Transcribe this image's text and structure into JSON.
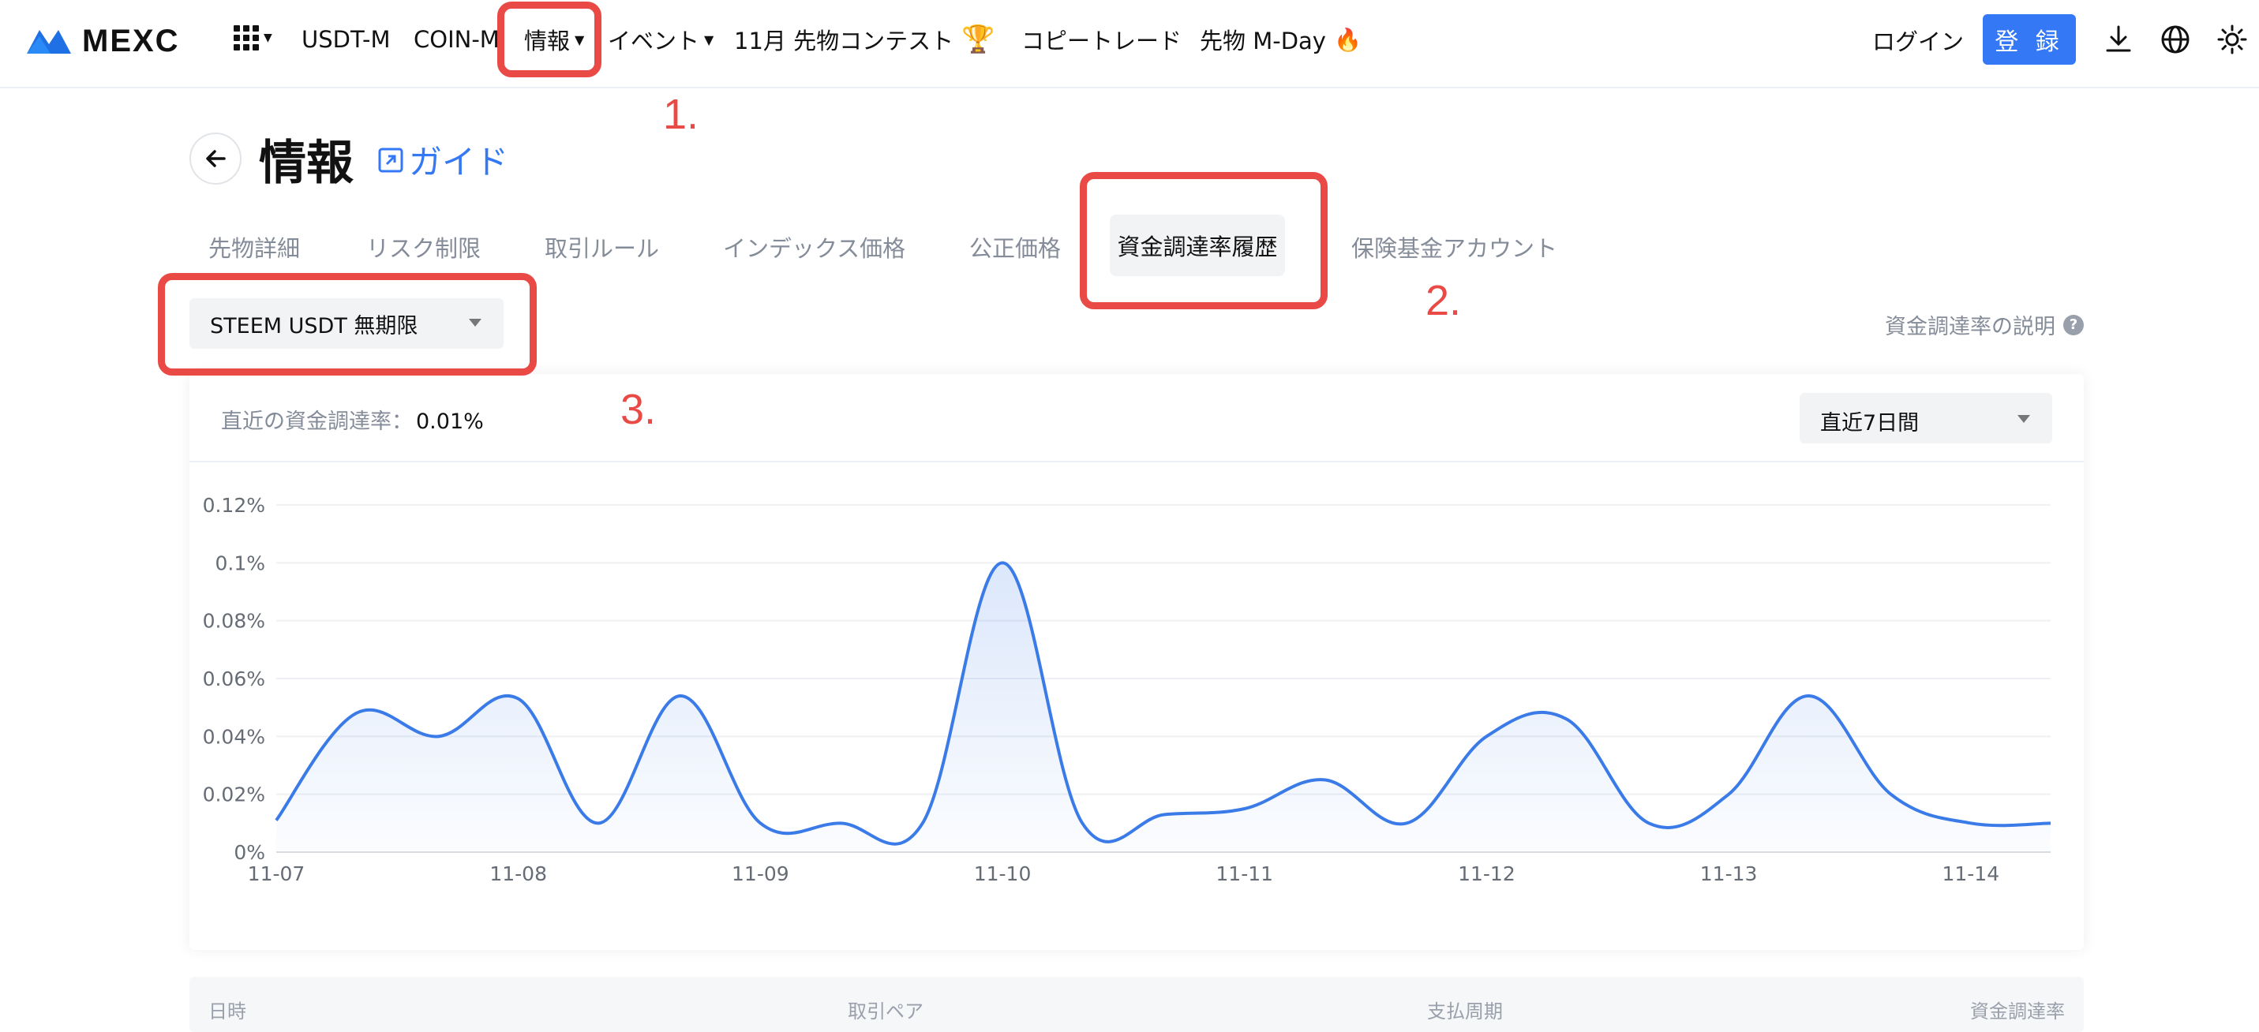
{
  "nav": {
    "brand": "MEXC",
    "usdt_m": "USDT-M",
    "coin_m": "COIN-M",
    "info": "情報",
    "event": "イベント",
    "contest": "11月 先物コンテスト",
    "copy_trade": "コピートレード",
    "mday": "先物 M-Day",
    "login": "ログイン",
    "register": "登 録"
  },
  "annotations": [
    "1.",
    "2.",
    "3."
  ],
  "page": {
    "title": "情報",
    "guide": "ガイド",
    "tabs": [
      {
        "label": "先物詳細",
        "active": false
      },
      {
        "label": "リスク制限",
        "active": false
      },
      {
        "label": "取引ルール",
        "active": false
      },
      {
        "label": "インデックス価格",
        "active": false
      },
      {
        "label": "公正価格",
        "active": false
      },
      {
        "label": "資金調達率履歴",
        "active": true
      },
      {
        "label": "保険基金アカウント",
        "active": false
      }
    ],
    "symbol": "STEEM USDT 無期限",
    "explain": "資金調達率の説明",
    "explain_icon": "?"
  },
  "card": {
    "recent_label": "直近の資金調達率：",
    "recent_value": "0.01%",
    "period": "直近7日間"
  },
  "colors": {
    "accent": "#3478f6",
    "annotation": "#ea4a45",
    "line": "#3a7be8"
  },
  "chart_data": {
    "type": "area",
    "y_ticks": [
      "0%",
      "0.02%",
      "0.04%",
      "0.06%",
      "0.08%",
      "0.1%",
      "0.12%"
    ],
    "x_ticks": [
      "11-07",
      "11-08",
      "11-09",
      "11-10",
      "11-11",
      "11-12",
      "11-13",
      "11-14"
    ],
    "ylim": [
      0,
      0.12
    ],
    "y_unit": "%",
    "grid": true,
    "series": [
      {
        "values": [
          [
            0.0,
            0.011
          ],
          [
            0.33,
            0.048
          ],
          [
            0.67,
            0.04
          ],
          [
            1.0,
            0.053
          ],
          [
            1.33,
            0.01
          ],
          [
            1.67,
            0.054
          ],
          [
            2.0,
            0.01
          ],
          [
            2.33,
            0.01
          ],
          [
            2.67,
            0.01
          ],
          [
            3.0,
            0.1
          ],
          [
            3.33,
            0.01
          ],
          [
            3.67,
            0.013
          ],
          [
            4.0,
            0.015
          ],
          [
            4.33,
            0.025
          ],
          [
            4.67,
            0.01
          ],
          [
            5.0,
            0.04
          ],
          [
            5.33,
            0.046
          ],
          [
            5.67,
            0.01
          ],
          [
            6.0,
            0.02
          ],
          [
            6.33,
            0.054
          ],
          [
            6.67,
            0.02
          ],
          [
            7.0,
            0.01
          ],
          [
            7.33,
            0.01
          ]
        ]
      }
    ]
  },
  "table": {
    "headers": [
      "日時",
      "取引ペア",
      "支払周期",
      "資金調達率"
    ]
  }
}
